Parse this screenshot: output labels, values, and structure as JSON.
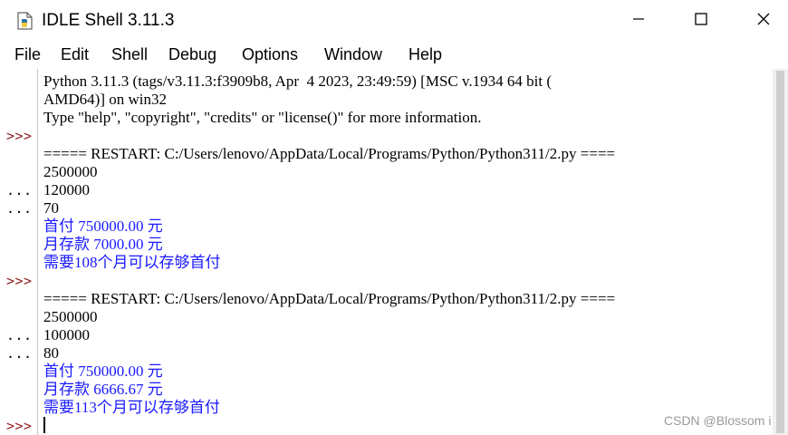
{
  "window": {
    "title": "IDLE Shell 3.11.3",
    "icons": {
      "app": "python-feather-icon",
      "minimize": "minimize-icon",
      "maximize": "maximize-icon",
      "close": "close-icon"
    }
  },
  "menu": [
    "File",
    "Edit",
    "Shell",
    "Debug",
    "Options",
    "Window",
    "Help"
  ],
  "gutter": [
    ">>>",
    "...",
    "...",
    ">>>",
    "...",
    "...",
    ">>>"
  ],
  "shell_lines": [
    "Python 3.11.3 (tags/v3.11.3:f3909b8, Apr  4 2023, 23:49:59) [MSC v.1934 64 bit (",
    "AMD64)] on win32",
    "Type \"help\", \"copyright\", \"credits\" or \"license()\" for more information.",
    "",
    "===== RESTART: C:/Users/lenovo/AppData/Local/Programs/Python/Python311/2.py ====",
    "2500000",
    "120000",
    "70",
    "首付 750000.00 元",
    "月存款 7000.00 元",
    "需要108个月可以存够首付",
    "",
    "===== RESTART: C:/Users/lenovo/AppData/Local/Programs/Python/Python311/2.py ====",
    "2500000",
    "100000",
    "80",
    "首付 750000.00 元",
    "月存款 6666.67 元",
    "需要113个月可以存够首付"
  ],
  "watermark": "CSDN @Blossom i",
  "colors": {
    "prompt": "#8b1c1c",
    "program_output": "#1a1aff",
    "input_text": "#000000"
  }
}
